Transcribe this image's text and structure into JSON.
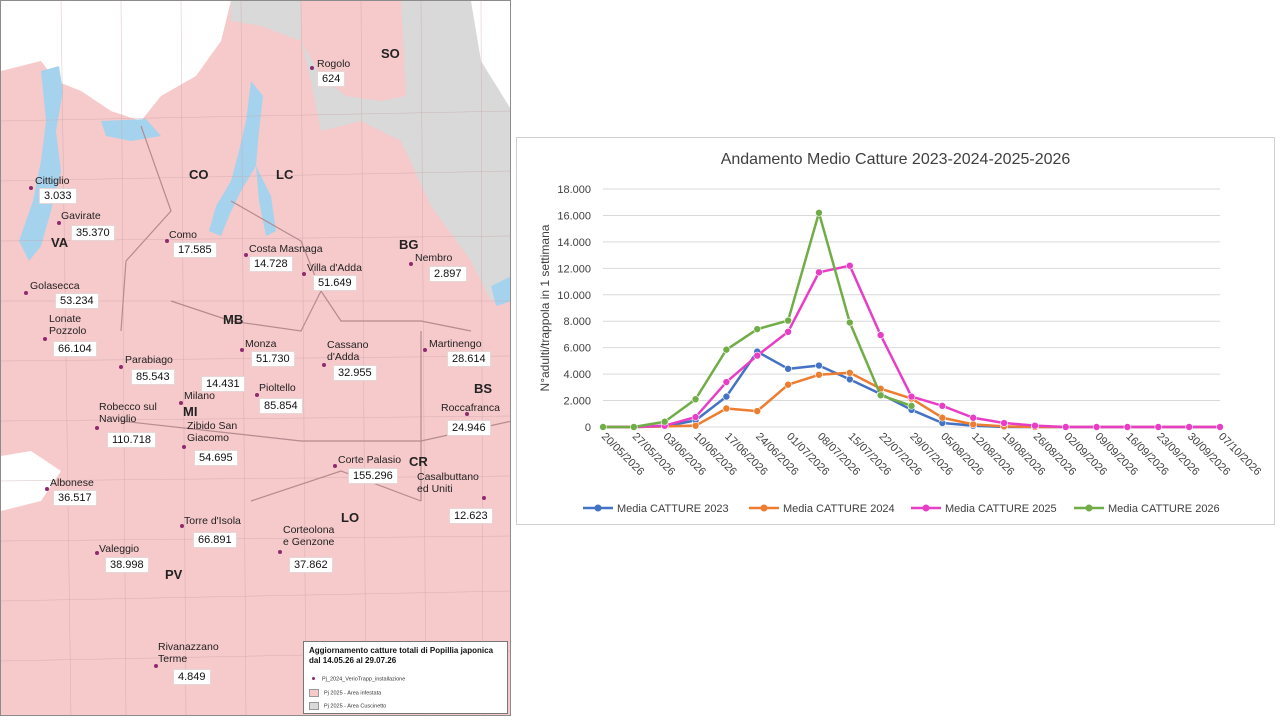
{
  "map": {
    "provinces": [
      {
        "code": "SO"
      },
      {
        "code": "CO"
      },
      {
        "code": "LC"
      },
      {
        "code": "VA"
      },
      {
        "code": "BG"
      },
      {
        "code": "MB"
      },
      {
        "code": "MI"
      },
      {
        "code": "BS"
      },
      {
        "code": "CR"
      },
      {
        "code": "LO"
      },
      {
        "code": "PV"
      }
    ],
    "stations": [
      {
        "name": "Rogolo",
        "value": "624"
      },
      {
        "name": "Cittiglio",
        "value": "3.033"
      },
      {
        "name": "Gavirate",
        "value": "35.370"
      },
      {
        "name": "Como",
        "value": "17.585"
      },
      {
        "name": "Costa Masnaga",
        "value": "14.728"
      },
      {
        "name": "Villa d'Adda",
        "value": "51.649"
      },
      {
        "name": "Nembro",
        "value": "2.897"
      },
      {
        "name": "Golasecca",
        "value": "53.234"
      },
      {
        "name": "Lonate\nPozzolo",
        "value": "66.104"
      },
      {
        "name": "Monza",
        "value": "51.730"
      },
      {
        "name": "Cassano\nd'Adda",
        "value": "32.955"
      },
      {
        "name": "Martinengo",
        "value": "28.614"
      },
      {
        "name": "Parabiago",
        "value": "85.543"
      },
      {
        "name": "Milano",
        "value": "14.431"
      },
      {
        "name": "Pioltello",
        "value": "85.854"
      },
      {
        "name": "Robecco sul\nNaviglio",
        "value": "110.718"
      },
      {
        "name": "Zibido San\nGiacomo",
        "value": "54.695"
      },
      {
        "name": "Roccafranca",
        "value": "24.946"
      },
      {
        "name": "Corte Palasio",
        "value": "155.296"
      },
      {
        "name": "Casalbuttano\ned Uniti",
        "value": "12.623"
      },
      {
        "name": "Albonese",
        "value": "36.517"
      },
      {
        "name": "Torre d'Isola",
        "value": "66.891"
      },
      {
        "name": "Corteolona\ne Genzone",
        "value": "37.862"
      },
      {
        "name": "Valeggio",
        "value": "38.998"
      },
      {
        "name": "Rivanazzano\nTerme",
        "value": "4.849"
      }
    ],
    "legend": {
      "title": "Aggiornamento catture totali di Popillia japonica\ndal 14.05.26 al 29.07.26",
      "items": [
        "Pj_2024_VerioTrapp_installazione",
        "Pj 2025 - Area infestata",
        "Pj 2025 - Area Cuscinetto"
      ]
    },
    "colors": {
      "infested": "#f6c9cb",
      "buffer": "#d9d9d9",
      "water": "#a5d3ee",
      "dot": "#8e2a6e"
    }
  },
  "chart_data": {
    "type": "line",
    "title": "Andamento Medio Catture 2023-2024-2025-2026",
    "ylabel": "N°adulti/trappola in 1 settimana",
    "xlabel": "",
    "ylim": [
      0,
      18000
    ],
    "yticks": [
      "0",
      "2.000",
      "4.000",
      "6.000",
      "8.000",
      "10.000",
      "12.000",
      "14.000",
      "16.000",
      "18.000"
    ],
    "grid": true,
    "legend_position": "bottom",
    "categories": [
      "20/05/2026",
      "27/05/2026",
      "03/06/2026",
      "10/06/2026",
      "17/06/2026",
      "24/06/2026",
      "01/07/2026",
      "08/07/2026",
      "15/07/2026",
      "22/07/2026",
      "29/07/2026",
      "05/08/2026",
      "12/08/2026",
      "19/08/2026",
      "26/08/2026",
      "02/09/2026",
      "09/09/2026",
      "16/09/2026",
      "23/09/2026",
      "30/09/2026",
      "07/10/2026"
    ],
    "series": [
      {
        "name": "Media CATTURE 2023",
        "color": "#4472c4",
        "values": [
          0,
          0,
          50,
          500,
          2300,
          5700,
          4400,
          4650,
          3600,
          2500,
          1300,
          300,
          100,
          0,
          0,
          0,
          0,
          0,
          0,
          0,
          0
        ]
      },
      {
        "name": "Media CATTURE 2024",
        "color": "#ed7d31",
        "values": [
          0,
          0,
          50,
          100,
          1400,
          1200,
          3200,
          3950,
          4100,
          2900,
          2150,
          700,
          200,
          50,
          0,
          0,
          0,
          0,
          0,
          0,
          0
        ]
      },
      {
        "name": "Media CATTURE 2025",
        "color": "#e83ec6",
        "values": [
          0,
          0,
          100,
          750,
          3400,
          5400,
          7200,
          11700,
          12200,
          6950,
          2300,
          1600,
          700,
          300,
          100,
          0,
          0,
          0,
          0,
          0,
          0
        ]
      },
      {
        "name": "Media CATTURE 2026",
        "color": "#70ad47",
        "values": [
          0,
          0,
          400,
          2100,
          5850,
          7400,
          8050,
          16200,
          7900,
          2400,
          1600,
          null,
          null,
          null,
          null,
          null,
          null,
          null,
          null,
          null,
          null
        ]
      }
    ]
  }
}
